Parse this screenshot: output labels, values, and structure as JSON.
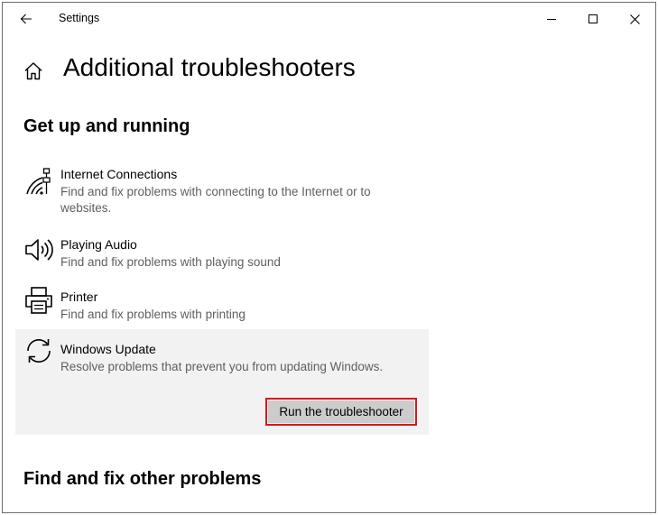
{
  "window": {
    "title": "Settings",
    "controls": {
      "minimize_icon": "minimize-icon",
      "maximize_icon": "maximize-icon",
      "close_icon": "close-icon"
    },
    "back_icon": "back-arrow-icon"
  },
  "header": {
    "home_icon": "home-icon",
    "title": "Additional troubleshooters"
  },
  "sections": [
    {
      "title": "Get up and running",
      "items": [
        {
          "icon": "wifi-network-icon",
          "name": "Internet Connections",
          "description": "Find and fix problems with connecting to the Internet or to websites."
        },
        {
          "icon": "speaker-icon",
          "name": "Playing Audio",
          "description": "Find and fix problems with playing sound"
        },
        {
          "icon": "printer-icon",
          "name": "Printer",
          "description": "Find and fix problems with printing"
        },
        {
          "icon": "sync-icon",
          "name": "Windows Update",
          "description": "Resolve problems that prevent you from updating Windows.",
          "selected": true,
          "action_label": "Run the troubleshooter"
        }
      ]
    },
    {
      "title": "Find and fix other problems"
    }
  ],
  "colors": {
    "highlight_border": "#d9161e",
    "selected_bg": "#f2f2f2",
    "button_bg": "#cccccc",
    "description_text": "#5f5f5f"
  }
}
